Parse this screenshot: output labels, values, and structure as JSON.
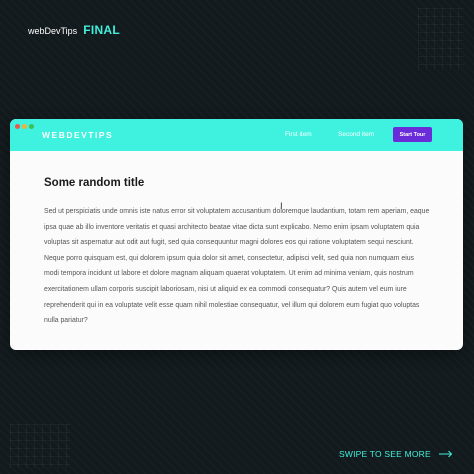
{
  "header": {
    "brand_small": "webDevTips",
    "brand_final": "FINAL"
  },
  "browser": {
    "logo": "WEBDEVTIPS",
    "nav": {
      "first_item": "First item",
      "second_item": "Second item",
      "cta": "Start Tour"
    },
    "content": {
      "title": "Some random title",
      "paragraph": "Sed ut perspiciatis unde omnis iste natus error sit voluptatem accusantium doloremque laudantium, totam rem aperiam, eaque ipsa quae ab illo inventore veritatis et quasi architecto beatae vitae dicta sunt explicabo. Nemo enim ipsam voluptatem quia voluptas sit aspernatur aut odit aut fugit, sed quia consequuntur magni dolores eos qui ratione voluptatem sequi nesciunt. Neque porro quisquam est, qui dolorem ipsum quia dolor sit amet, consectetur, adipisci velit, sed quia non numquam eius modi tempora incidunt ut labore et dolore magnam aliquam quaerat voluptatem. Ut enim ad minima veniam, quis nostrum exercitationem ullam corporis suscipit laboriosam, nisi ut aliquid ex ea commodi consequatur? Quis autem vel eum iure reprehenderit qui in ea voluptate velit esse quam nihil molestiae consequatur, vel illum qui dolorem eum fugiat quo voluptas nulla pariatur?"
    }
  },
  "footer": {
    "swipe_text": "SWIPE TO SEE MORE"
  },
  "colors": {
    "accent": "#3ef2df",
    "background": "#121a1d",
    "cta": "#6a2bd8"
  },
  "icons": {
    "window_controls": [
      "red-dot-icon",
      "yellow-dot-icon",
      "green-dot-icon"
    ],
    "cursor": "text-cursor-icon",
    "arrow": "arrow-right-icon"
  }
}
